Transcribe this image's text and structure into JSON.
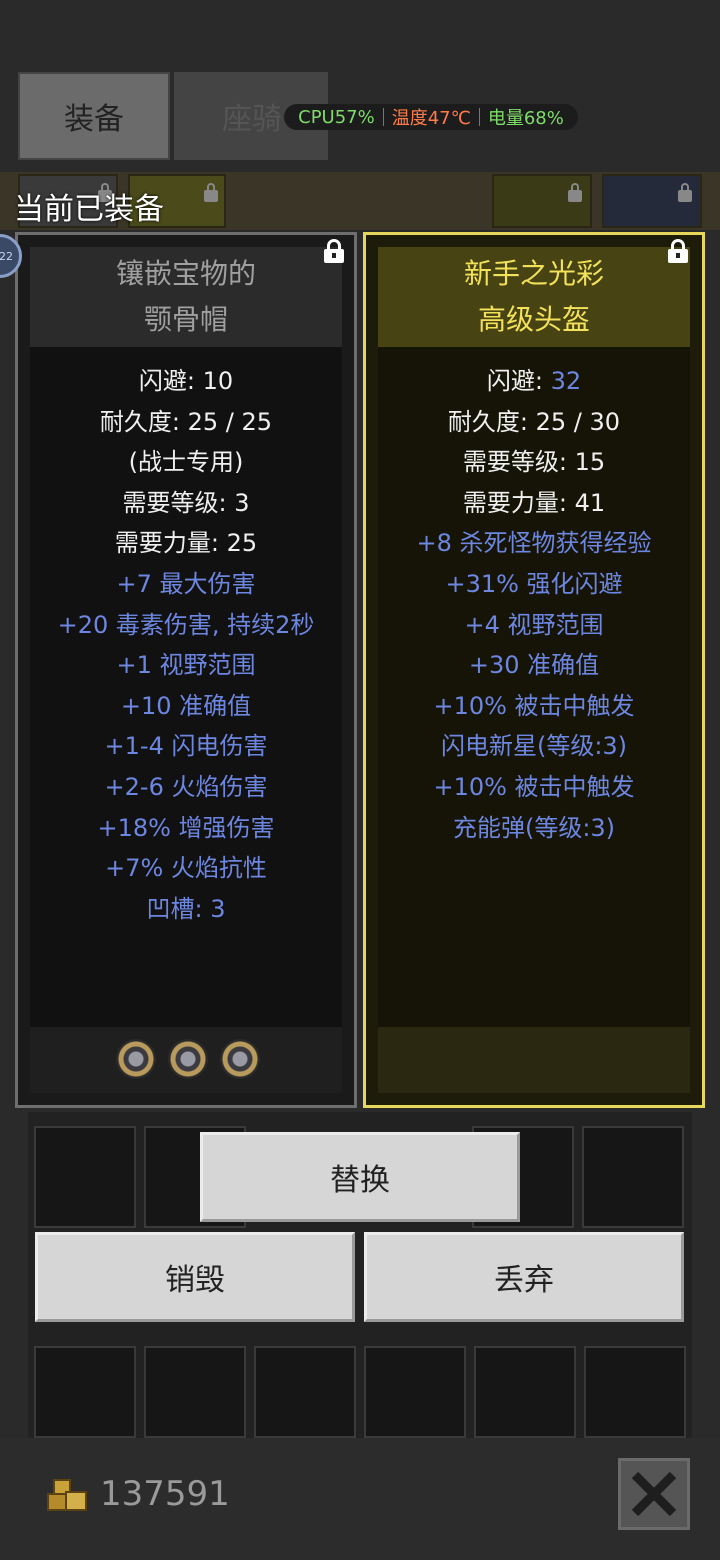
{
  "tabs": {
    "equip_label": "装备",
    "mount_label": "座骑"
  },
  "status": {
    "cpu": "CPU57%",
    "temp": "温度47℃",
    "battery": "电量68%",
    "colors": {
      "cpu": "#7fdc6a",
      "temp": "#ff7b4a",
      "battery": "#7fdc6a"
    }
  },
  "section_label": "当前已装备",
  "side_badge": "22",
  "current_item": {
    "name_line1": "镶嵌宝物的",
    "name_line2": "颚骨帽",
    "stats": [
      "闪避: 10",
      "耐久度: 25 / 25",
      "(战士专用)",
      "需要等级: 3",
      "需要力量: 25"
    ],
    "affixes": [
      "+7 最大伤害",
      "+20 毒素伤害, 持续2秒",
      "+1 视野范围",
      "+10 准确值",
      "+1-4 闪电伤害",
      "+2-6 火焰伤害",
      "+18% 增强伤害",
      "+7% 火焰抗性",
      "凹槽: 3"
    ]
  },
  "new_item": {
    "name_line1": "新手之光彩",
    "name_line2": "高级头盔",
    "dodge_label": "闪避: ",
    "dodge_value": "32",
    "stats": [
      "耐久度: 25 / 30",
      "需要等级: 15",
      "需要力量: 41"
    ],
    "affixes": [
      "+8 杀死怪物获得经验",
      "+31% 强化闪避",
      "+4 视野范围",
      "+30 准确值",
      "+10% 被击中触发",
      "闪电新星(等级:3)",
      "+10% 被击中触发",
      "充能弹(等级:3)"
    ]
  },
  "actions": {
    "replace": "替换",
    "destroy": "销毁",
    "discard": "丢弃"
  },
  "gold": "137591",
  "icons": [
    "lock-icon",
    "socket-gem-icon",
    "gold-coins-icon",
    "close-icon"
  ]
}
